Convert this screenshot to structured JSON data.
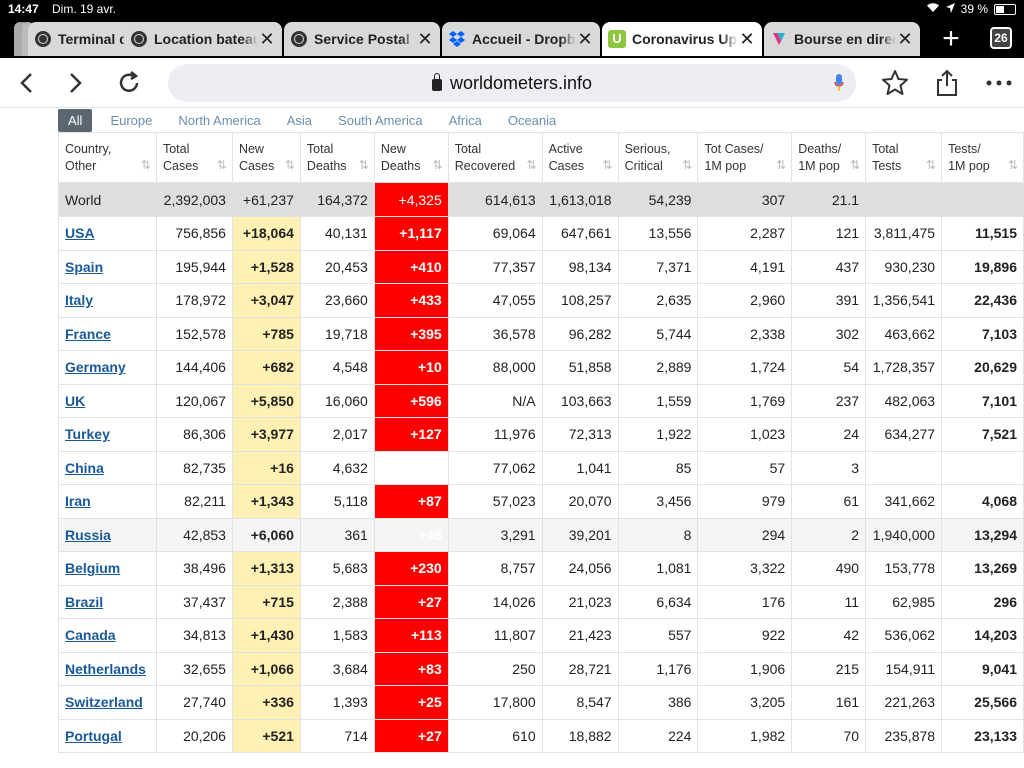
{
  "status": {
    "time": "14:47",
    "date": "Dim. 19 avr.",
    "battery": "39 %",
    "battery_level": 0.39
  },
  "tabs": [
    {
      "label": "Terminal de",
      "icon": "globe-icon",
      "active": false
    },
    {
      "label": "Location bateau",
      "icon": "globe-icon",
      "active": false
    },
    {
      "label": "Service Postal",
      "icon": "globe-icon",
      "active": false
    },
    {
      "label": "Accueil - Dropbox",
      "icon": "dropbox-icon",
      "active": false
    },
    {
      "label": "Coronavirus Update",
      "icon": "worldometers-icon",
      "active": true
    },
    {
      "label": "Bourse en direct",
      "icon": "bourse-icon",
      "active": false
    }
  ],
  "tab_count": "26",
  "url": "worldometers.info",
  "regions": [
    "All",
    "Europe",
    "North America",
    "Asia",
    "South America",
    "Africa",
    "Oceania"
  ],
  "columns": [
    "Country,\nOther",
    "Total\nCases",
    "New\nCases",
    "Total\nDeaths",
    "New\nDeaths",
    "Total\nRecovered",
    "Active\nCases",
    "Serious,\nCritical",
    "Tot Cases/\n1M pop",
    "Deaths/\n1M pop",
    "Total\nTests",
    "Tests/\n1M pop"
  ],
  "rows": [
    [
      "World",
      "2,392,003",
      "+61,237",
      "164,372",
      "+4,325",
      "614,613",
      "1,613,018",
      "54,239",
      "307",
      "21.1",
      "",
      ""
    ],
    [
      "USA",
      "756,856",
      "+18,064",
      "40,131",
      "+1,117",
      "69,064",
      "647,661",
      "13,556",
      "2,287",
      "121",
      "3,811,475",
      "11,515"
    ],
    [
      "Spain",
      "195,944",
      "+1,528",
      "20,453",
      "+410",
      "77,357",
      "98,134",
      "7,371",
      "4,191",
      "437",
      "930,230",
      "19,896"
    ],
    [
      "Italy",
      "178,972",
      "+3,047",
      "23,660",
      "+433",
      "47,055",
      "108,257",
      "2,635",
      "2,960",
      "391",
      "1,356,541",
      "22,436"
    ],
    [
      "France",
      "152,578",
      "+785",
      "19,718",
      "+395",
      "36,578",
      "96,282",
      "5,744",
      "2,338",
      "302",
      "463,662",
      "7,103"
    ],
    [
      "Germany",
      "144,406",
      "+682",
      "4,548",
      "+10",
      "88,000",
      "51,858",
      "2,889",
      "1,724",
      "54",
      "1,728,357",
      "20,629"
    ],
    [
      "UK",
      "120,067",
      "+5,850",
      "16,060",
      "+596",
      "N/A",
      "103,663",
      "1,559",
      "1,769",
      "237",
      "482,063",
      "7,101"
    ],
    [
      "Turkey",
      "86,306",
      "+3,977",
      "2,017",
      "+127",
      "11,976",
      "72,313",
      "1,922",
      "1,023",
      "24",
      "634,277",
      "7,521"
    ],
    [
      "China",
      "82,735",
      "+16",
      "4,632",
      "",
      "77,062",
      "1,041",
      "85",
      "57",
      "3",
      "",
      ""
    ],
    [
      "Iran",
      "82,211",
      "+1,343",
      "5,118",
      "+87",
      "57,023",
      "20,070",
      "3,456",
      "979",
      "61",
      "341,662",
      "4,068"
    ],
    [
      "Russia",
      "42,853",
      "+6,060",
      "361",
      "+48",
      "3,291",
      "39,201",
      "8",
      "294",
      "2",
      "1,940,000",
      "13,294"
    ],
    [
      "Belgium",
      "38,496",
      "+1,313",
      "5,683",
      "+230",
      "8,757",
      "24,056",
      "1,081",
      "3,322",
      "490",
      "153,778",
      "13,269"
    ],
    [
      "Brazil",
      "37,437",
      "+715",
      "2,388",
      "+27",
      "14,026",
      "21,023",
      "6,634",
      "176",
      "11",
      "62,985",
      "296"
    ],
    [
      "Canada",
      "34,813",
      "+1,430",
      "1,583",
      "+113",
      "11,807",
      "21,423",
      "557",
      "922",
      "42",
      "536,062",
      "14,203"
    ],
    [
      "Netherlands",
      "32,655",
      "+1,066",
      "3,684",
      "+83",
      "250",
      "28,721",
      "1,176",
      "1,906",
      "215",
      "154,911",
      "9,041"
    ],
    [
      "Switzerland",
      "27,740",
      "+336",
      "1,393",
      "+25",
      "17,800",
      "8,547",
      "386",
      "3,205",
      "161",
      "221,263",
      "25,566"
    ],
    [
      "Portugal",
      "20,206",
      "+521",
      "714",
      "+27",
      "610",
      "18,882",
      "224",
      "1,982",
      "70",
      "235,878",
      "23,133"
    ]
  ]
}
